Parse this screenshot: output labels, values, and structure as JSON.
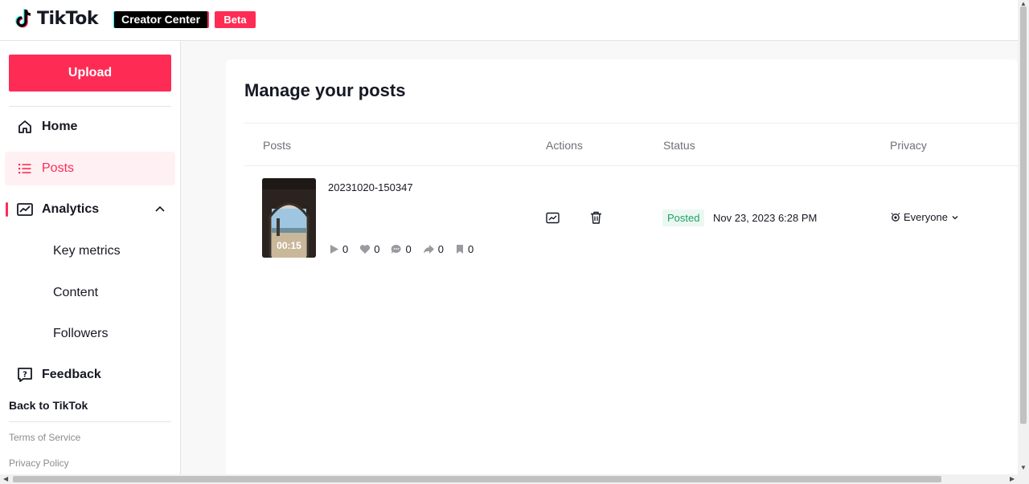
{
  "header": {
    "brand": "TikTok",
    "creator_center": "Creator Center",
    "beta": "Beta"
  },
  "sidebar": {
    "upload": "Upload",
    "nav": {
      "home": "Home",
      "posts": "Posts",
      "analytics": "Analytics",
      "key_metrics": "Key metrics",
      "content": "Content",
      "followers": "Followers",
      "feedback": "Feedback"
    },
    "back": "Back to TikTok",
    "terms": "Terms of Service",
    "privacy_policy": "Privacy Policy"
  },
  "main": {
    "title": "Manage your posts",
    "columns": [
      "Posts",
      "Actions",
      "Status",
      "Privacy"
    ],
    "posts": [
      {
        "title": "20231020-150347",
        "duration": "00:15",
        "views": "0",
        "likes": "0",
        "comments": "0",
        "shares": "0",
        "saves": "0",
        "status": "Posted",
        "date": "Nov 23, 2023 6:28 PM",
        "privacy": "Everyone"
      }
    ]
  },
  "colors": {
    "brand": "#fe2c55",
    "posted_bg": "#ebf8f2",
    "posted_text": "#1fa068"
  }
}
